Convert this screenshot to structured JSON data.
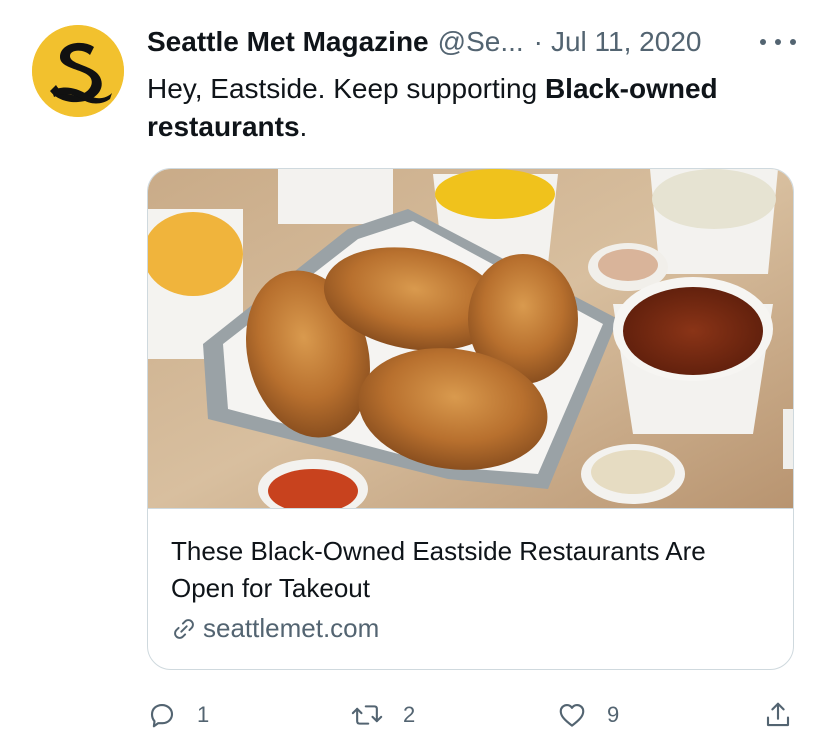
{
  "tweet": {
    "author": {
      "display_name": "Seattle Met Magazine",
      "handle": "@Se...",
      "avatar_icon": "seattle-met-s-logo",
      "avatar_color": "#f2c12e"
    },
    "separator": "·",
    "date": "Jul 11, 2020",
    "more_icon": "more-horizontal-icon",
    "text": {
      "part1": "Hey, Eastside. Keep supporting ",
      "bold": "Black-owned restaurants",
      "part2": "."
    },
    "card": {
      "image_description_icon": "fried-chicken-photo",
      "title": "These Black-Owned Eastside Restaurants Are Open for Takeout",
      "domain": "seattlemet.com",
      "link_icon": "link-icon"
    },
    "actions": {
      "reply": {
        "icon": "reply-icon",
        "count": "1"
      },
      "retweet": {
        "icon": "retweet-icon",
        "count": "2"
      },
      "like": {
        "icon": "heart-icon",
        "count": "9"
      },
      "share": {
        "icon": "share-icon"
      }
    },
    "colors": {
      "text_primary": "#0f1419",
      "text_secondary": "#536471",
      "border": "#cfd9de"
    }
  }
}
